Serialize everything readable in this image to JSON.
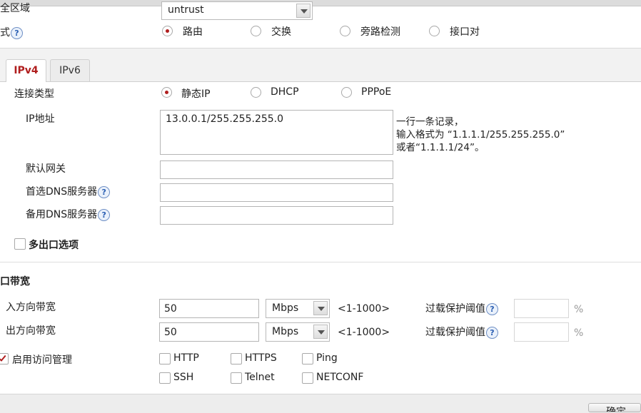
{
  "top": {
    "zone_label": "安全区域",
    "zone_value": "untrust",
    "mode_label": "模式",
    "mode_options": [
      "路由",
      "交换",
      "旁路检测",
      "接口对"
    ]
  },
  "tabs": [
    "IPv4",
    "IPv6"
  ],
  "ipv4": {
    "conn_type_label": "连接类型",
    "conn_type_options": [
      "静态IP",
      "DHCP",
      "PPPoE"
    ],
    "ip_label": "IP地址",
    "ip_value": "13.0.0.1/255.255.255.0",
    "ip_hint": [
      "一行一条记录，",
      "输入格式为 “1.1.1.1/255.255.255.0”",
      "或者“1.1.1.1/24”。"
    ],
    "gateway_label": "默认网关",
    "gateway_value": "",
    "dns1_label": "首选DNS服务器",
    "dns1_value": "",
    "dns2_label": "备用DNS服务器",
    "dns2_value": "",
    "multi_exit_label": "多出口选项"
  },
  "bandwidth": {
    "section_title": "接口带宽",
    "inbound": {
      "label": "入方向带宽",
      "value": "50",
      "unit": "Mbps",
      "range": "<1-1000>",
      "threshold_label": "过载保护阈值",
      "threshold_value": "",
      "pct": "%"
    },
    "outbound": {
      "label": "出方向带宽",
      "value": "50",
      "unit": "Mbps",
      "range": "<1-1000>",
      "threshold_label": "过载保护阈值",
      "threshold_value": "",
      "pct": "%"
    }
  },
  "access": {
    "label": "启用访问管理",
    "options": [
      "HTTP",
      "HTTPS",
      "Ping",
      "SSH",
      "Telnet",
      "NETCONF"
    ]
  },
  "footer": {
    "confirm_label": "确定"
  },
  "icons": {
    "help": "?"
  },
  "colors": {
    "accent": "#b01e1e",
    "help": "#2b5fb3"
  }
}
